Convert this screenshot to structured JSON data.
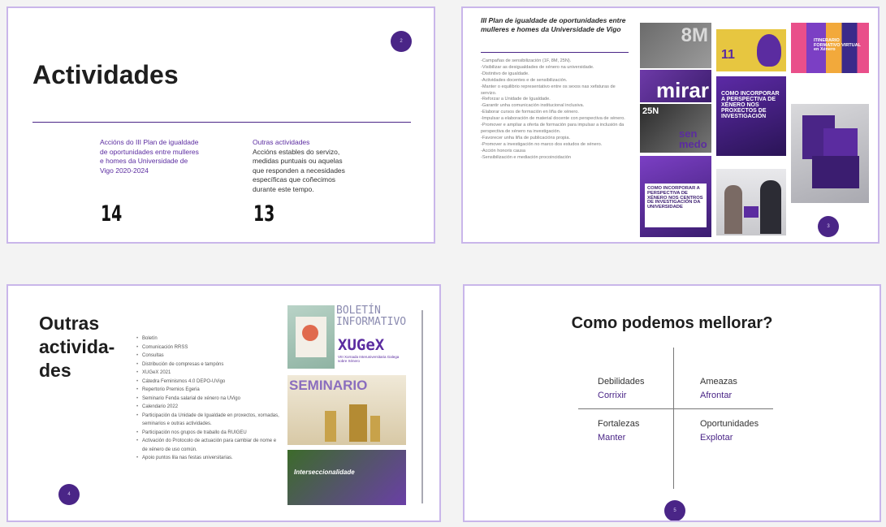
{
  "slides": [
    {
      "title": "Actividades",
      "page_num": "2",
      "columns": [
        {
          "heading": "Accións do III Plan de igualdade de oportunidades entre mulleres e homes da Universidade de Vigo 2020-2024",
          "body": "",
          "count": "14"
        },
        {
          "heading": "Outras actividades",
          "body": "Accións estables do servizo, medidas puntuais ou aquelas que responden a necesidades específicas que coñecimos durante este tempo.",
          "count": "13"
        }
      ]
    },
    {
      "heading": "III Plan de igualdade de oportunidades entre mulleres e homes da Universidade de Vigo",
      "page_num": "3",
      "items": [
        "-Campañas de sensibilización (1F, 8M, 25N).",
        "-Visibilizar as desigualdades de xénero na universidade.",
        "-Distintivo de igualdade.",
        "-Actividades docentes e de sensibilización.",
        "-Manter o equilibrio representativo entre os sexos nas xefaturas de servizo.",
        "-Reforzar a Unidade de Igualdade.",
        "-Garantir unha comunicación institucional inclusiva.",
        "-Elaborar cursos de formación en liña de xénero.",
        "-Impulsar a elaboración de material docente con perspectiva de xénero.",
        "-Promover e ampliar a oferta de formación para impulsar a inclusión da perspectiva de xénero na investigación.",
        "-Favorecer unha liña de publicacións propia.",
        "-Promover a investigación no marco dos estudos de xénero.",
        "-Acción honoris causa",
        "-Sensibilización e mediación procoincidación"
      ],
      "tiles": {
        "t1_top": "8M",
        "t1_bottom": "mirar",
        "t2": "11",
        "t3": "ITINERARIO FORMATIVO VIRTUAL en Xénero",
        "t4": "COMO INCORPORAR A PERSPECTIVA DE XÉNERO NOS PROXECTOS DE INVESTIGACIÓN",
        "t5_a": "25N",
        "t5_b": "sen medo",
        "t6": "COMO INCORPORAR A PERSPECTIVA DE XÉNERO NOS CENTROS DE INVESTIGACIÓN DA UNIVERSIDADE"
      }
    },
    {
      "title_lines": [
        "Outras",
        "activida-",
        "des"
      ],
      "page_num": "4",
      "items": [
        "Boletín",
        "Comunicación RRSS",
        "Consultas",
        "Distribución de compresas e tampóns",
        "XUGeX 2021",
        "Cátedra Feminismos 4.0 DEPO-UVigo",
        "Repertorio Premios Egeria",
        "Seminario Fenda salarial de xénero na UVigo",
        "Calendario 2022",
        "Participación da Unidade de Igualdade en proxectos, xornadas, seminarios e outras actividades.",
        "Participación nos grupos de traballo da RUIGEU",
        "Activación do Protocolo de actuación para cambiar de nome e de xénero de uso común.",
        "Apoio puntos lila nas festas universitarias."
      ],
      "images": {
        "boletin": "BOLETÍN INFORMATIVO",
        "xugex": "XUGeX",
        "xugex_sub": "VIII Xornada Interuniversitaria Galega sobre Xénero",
        "seminario": "SEMINARIO",
        "bottom": "Interseccionalidade"
      }
    },
    {
      "title": "Como podemos mellorar?",
      "page_num": "5",
      "quadrants": [
        {
          "label": "Debilidades",
          "action": "Corrixir"
        },
        {
          "label": "Ameazas",
          "action": "Afrontar"
        },
        {
          "label": "Fortalezas",
          "action": "Manter"
        },
        {
          "label": "Oportunidades",
          "action": "Explotar"
        }
      ]
    }
  ],
  "colors": {
    "accent": "#4a2587",
    "border": "#c9b6ea"
  }
}
